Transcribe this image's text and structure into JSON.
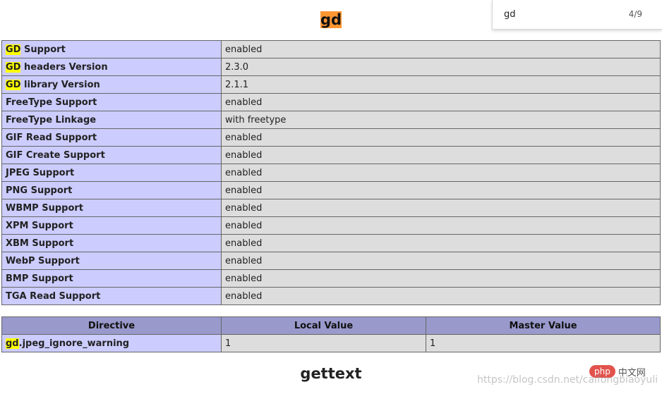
{
  "find_bar": {
    "query": "gd",
    "match_count": "4/9"
  },
  "module": {
    "title": "gd",
    "next_title": "gettext"
  },
  "info_table": [
    {
      "label_hl": "GD",
      "label_rest": " Support",
      "value": "enabled"
    },
    {
      "label_hl": "GD",
      "label_rest": " headers Version",
      "value": "2.3.0"
    },
    {
      "label_hl": "GD",
      "label_rest": " library Version",
      "value": "2.1.1"
    },
    {
      "label_hl": "",
      "label_rest": "FreeType Support",
      "value": "enabled"
    },
    {
      "label_hl": "",
      "label_rest": "FreeType Linkage",
      "value": "with freetype"
    },
    {
      "label_hl": "",
      "label_rest": "GIF Read Support",
      "value": "enabled"
    },
    {
      "label_hl": "",
      "label_rest": "GIF Create Support",
      "value": "enabled"
    },
    {
      "label_hl": "",
      "label_rest": "JPEG Support",
      "value": "enabled"
    },
    {
      "label_hl": "",
      "label_rest": "PNG Support",
      "value": "enabled"
    },
    {
      "label_hl": "",
      "label_rest": "WBMP Support",
      "value": "enabled"
    },
    {
      "label_hl": "",
      "label_rest": "XPM Support",
      "value": "enabled"
    },
    {
      "label_hl": "",
      "label_rest": "XBM Support",
      "value": "enabled"
    },
    {
      "label_hl": "",
      "label_rest": "WebP Support",
      "value": "enabled"
    },
    {
      "label_hl": "",
      "label_rest": "BMP Support",
      "value": "enabled"
    },
    {
      "label_hl": "",
      "label_rest": "TGA Read Support",
      "value": "enabled"
    }
  ],
  "directive_table": {
    "headers": [
      "Directive",
      "Local Value",
      "Master Value"
    ],
    "rows": [
      {
        "name_hl": "gd",
        "name_rest": ".jpeg_ignore_warning",
        "local": "1",
        "master": "1"
      }
    ]
  },
  "watermark": {
    "logo_text": "php",
    "site_text": "中文网",
    "url": "https://blog.csdn.net/caifongbiaoyuli"
  },
  "colors": {
    "label_cell": "#ccccff",
    "value_cell": "#dddddd",
    "header_cell": "#9999cc",
    "current_match": "#ff9632",
    "other_match": "#ffff00"
  }
}
